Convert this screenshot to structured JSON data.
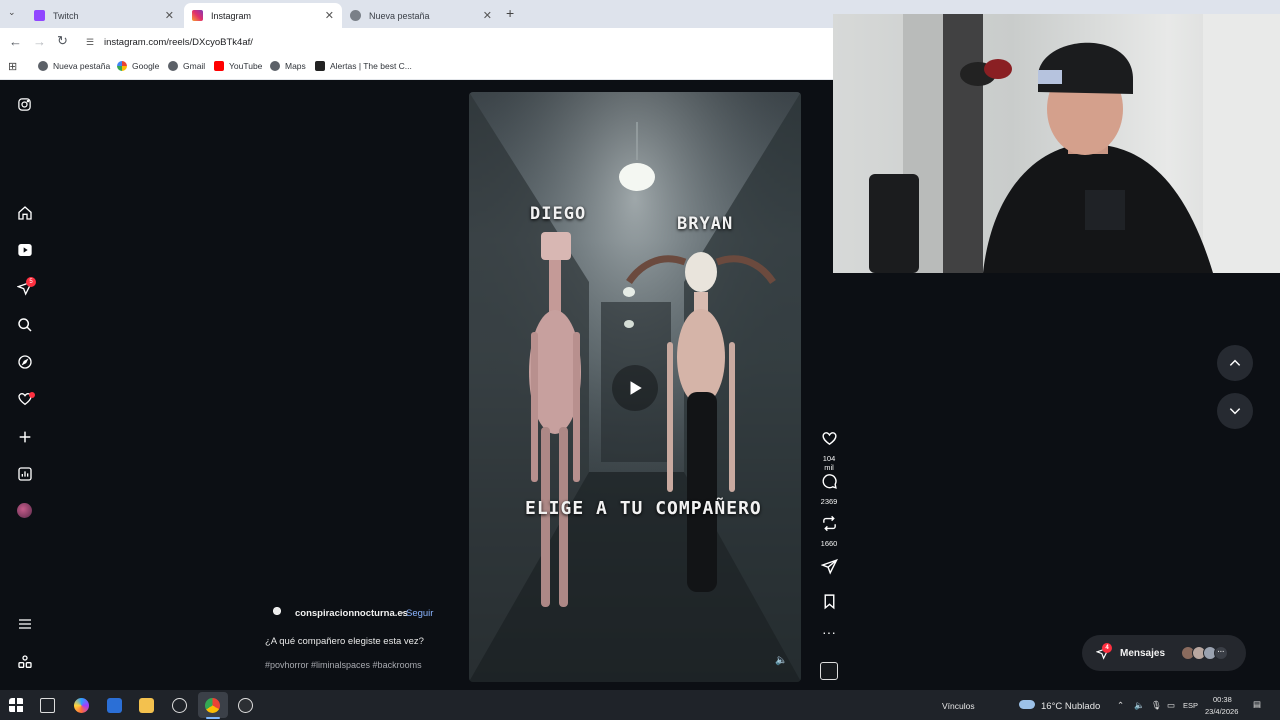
{
  "browser": {
    "tabs": [
      {
        "title": "Twitch",
        "active": false
      },
      {
        "title": "Instagram",
        "active": true
      },
      {
        "title": "Nueva pestaña",
        "active": false
      }
    ],
    "new_tab_symbol": "+",
    "url": "instagram.com/reels/DXcyoBTk4af/",
    "bookmarks": [
      "Nueva pestaña",
      "Google",
      "Gmail",
      "YouTube",
      "Maps",
      "Alertas | The best C..."
    ]
  },
  "instagram": {
    "notification_badge": "5",
    "video": {
      "name_left": "DIEGO",
      "name_right": "BRYAN",
      "caption_overlay": "ELIGE A TU COMPAÑERO"
    },
    "actions": {
      "likes": "104 mil",
      "comments": "2369",
      "reposts": "1660"
    },
    "post": {
      "username": "conspiracionnocturna.es",
      "separator": "•",
      "follow_label": "Seguir",
      "caption": "¿A qué compañero elegiste esta vez?",
      "hashtags": "#povhorror #liminalspaces #backrooms"
    },
    "messages": {
      "label": "Mensajes",
      "badge": "4"
    }
  },
  "taskbar": {
    "links_label": "Vínculos",
    "weather": "16°C  Nublado",
    "language": "ESP",
    "time": "00:38",
    "date": "23/4/2026"
  },
  "colors": {
    "instagram_bg": "#0c0f14",
    "notification_red": "#ff3040",
    "follow_blue": "#8ab4ff"
  }
}
